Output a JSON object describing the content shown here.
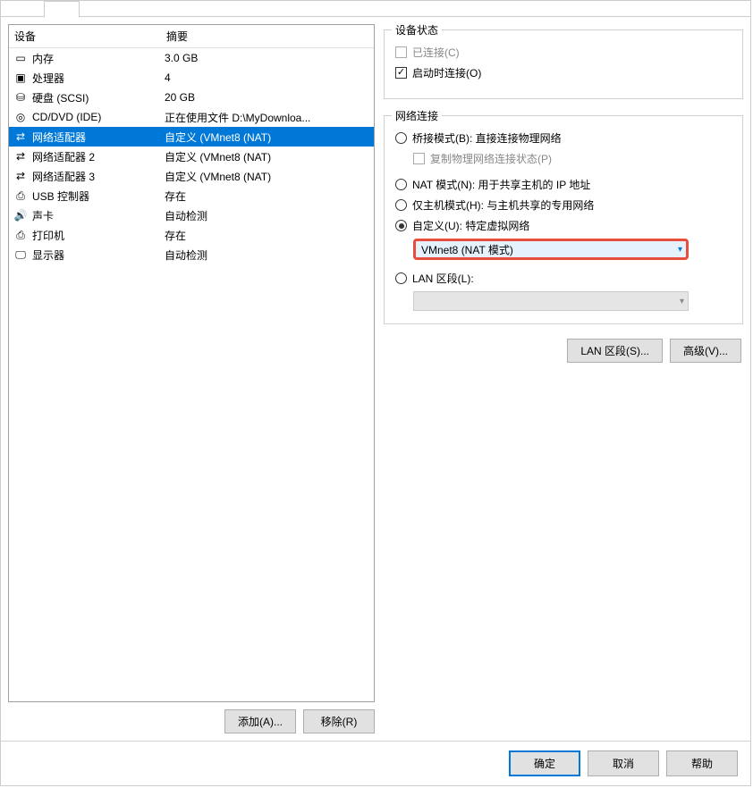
{
  "left": {
    "header_device": "设备",
    "header_summary": "摘要",
    "rows": [
      {
        "icon": "memory-icon",
        "name": "内存",
        "summary": "3.0 GB"
      },
      {
        "icon": "cpu-icon",
        "name": "处理器",
        "summary": "4"
      },
      {
        "icon": "disk-icon",
        "name": "硬盘 (SCSI)",
        "summary": "20 GB"
      },
      {
        "icon": "cd-icon",
        "name": "CD/DVD (IDE)",
        "summary": "正在使用文件 D:\\MyDownloa..."
      },
      {
        "icon": "network-icon",
        "name": "网络适配器",
        "summary": "自定义 (VMnet8 (NAT)",
        "selected": true
      },
      {
        "icon": "network-icon",
        "name": "网络适配器 2",
        "summary": "自定义 (VMnet8 (NAT)"
      },
      {
        "icon": "network-icon",
        "name": "网络适配器 3",
        "summary": "自定义 (VMnet8 (NAT)"
      },
      {
        "icon": "usb-icon",
        "name": "USB 控制器",
        "summary": "存在"
      },
      {
        "icon": "sound-icon",
        "name": "声卡",
        "summary": "自动检测"
      },
      {
        "icon": "printer-icon",
        "name": "打印机",
        "summary": "存在"
      },
      {
        "icon": "display-icon",
        "name": "显示器",
        "summary": "自动检测"
      }
    ],
    "add_button": "添加(A)...",
    "remove_button": "移除(R)"
  },
  "right": {
    "status_group": "设备状态",
    "connected": "已连接(C)",
    "connect_on_power": "启动时连接(O)",
    "network_group": "网络连接",
    "bridged": "桥接模式(B): 直接连接物理网络",
    "replicate": "复制物理网络连接状态(P)",
    "nat": "NAT 模式(N): 用于共享主机的 IP 地址",
    "hostonly": "仅主机模式(H): 与主机共享的专用网络",
    "custom": "自定义(U): 特定虚拟网络",
    "custom_value": "VMnet8 (NAT 模式)",
    "lan_segment": "LAN 区段(L):",
    "lan_segments_btn": "LAN 区段(S)...",
    "advanced_btn": "高级(V)..."
  },
  "bottom": {
    "ok": "确定",
    "cancel": "取消",
    "help": "帮助"
  }
}
